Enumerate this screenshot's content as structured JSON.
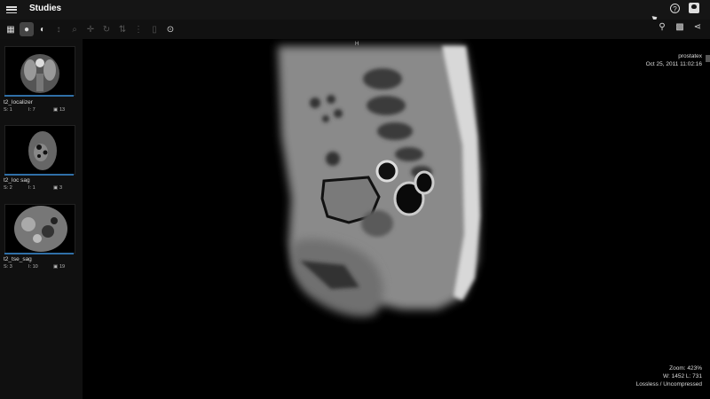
{
  "header": {
    "title": "Studies",
    "menu_icon": "menu-icon",
    "help_icon": "help-icon",
    "user_icon": "user-icon"
  },
  "toolbar": {
    "tools": [
      "layout-icon",
      "mouse-icon",
      "contrast-icon",
      "pan-icon",
      "zoom-icon",
      "crosshair-icon",
      "rotate-icon",
      "flip-icon",
      "scroll-icon",
      "stack-icon",
      "play-icon"
    ],
    "right_tools": [
      "pin-icon",
      "grid-icon",
      "share-icon"
    ]
  },
  "series": [
    {
      "label": "t2_localizer",
      "s": "S: 1",
      "i": "I: 7",
      "count": "13"
    },
    {
      "label": "t2_loc sag",
      "s": "S: 2",
      "i": "I: 1",
      "count": "3"
    },
    {
      "label": "t2_tse_sag",
      "s": "S: 3",
      "i": "I: 10",
      "count": "19"
    }
  ],
  "viewport": {
    "orientation_marker": "H",
    "patient": "prostatex",
    "date": "Oct 25, 2011 11:02:16",
    "zoom": "Zoom: 423%",
    "window": "W: 1452 L: 731",
    "compression": "Lossless / Uncompressed"
  },
  "colors": {
    "accent": "#2f6fa7",
    "background": "#000000"
  }
}
